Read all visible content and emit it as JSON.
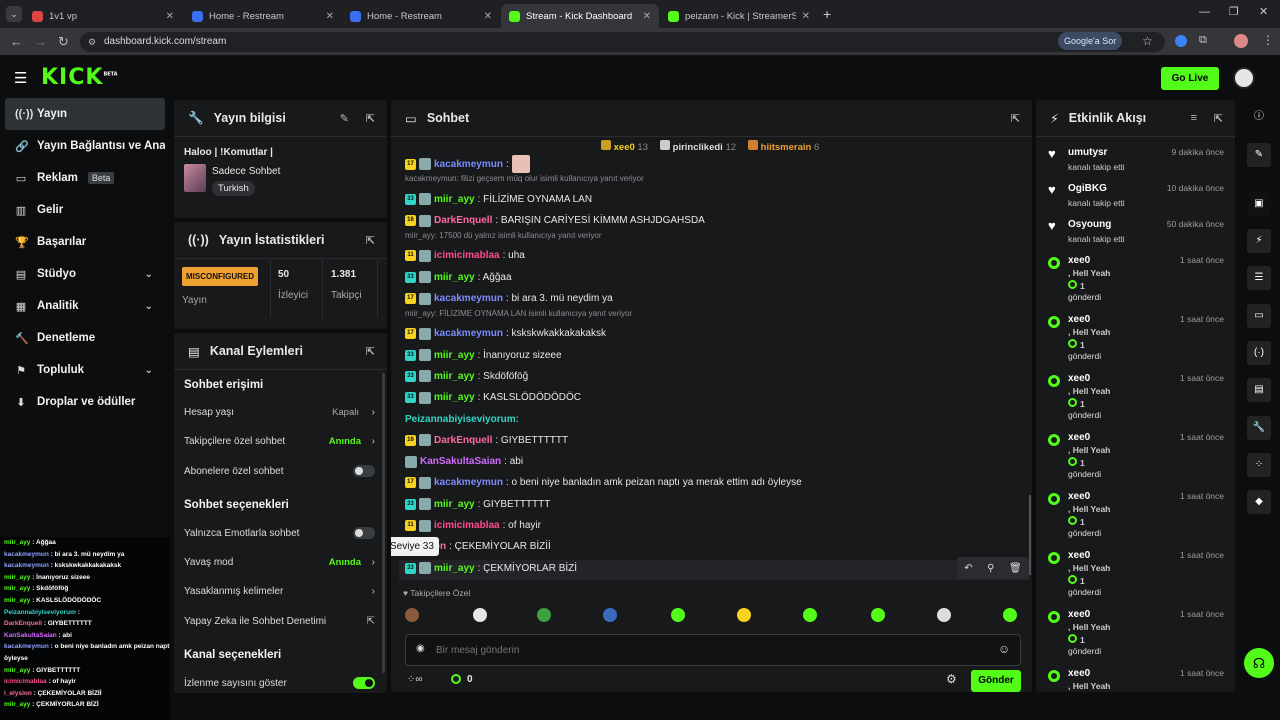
{
  "browser": {
    "tabs": [
      {
        "title": "1v1 vp",
        "color": "#d44"
      },
      {
        "title": "Home - Restream",
        "color": "#3b6df0"
      },
      {
        "title": "Home - Restream",
        "color": "#3b6df0"
      },
      {
        "title": "Stream - Kick Dashboard",
        "color": "#53fc18"
      },
      {
        "title": "peizann - Kick | StreamerStats",
        "color": "#53fc18"
      }
    ],
    "url": "dashboard.kick.com/stream",
    "google_btn": "Google'a Sor"
  },
  "header": {
    "logo": "KICK",
    "logo_sup": "BETA",
    "go_live": "Go Live"
  },
  "sidebar": {
    "items": [
      {
        "label": "Yayın",
        "icon": "broadcast-icon"
      },
      {
        "label": "Yayın Bağlantısı ve Anahtarı",
        "icon": "link-icon"
      },
      {
        "label": "Reklam",
        "icon": "ad-icon",
        "badge": "Beta"
      },
      {
        "label": "Gelir",
        "icon": "revenue-icon"
      },
      {
        "label": "Başarılar",
        "icon": "trophy-icon"
      },
      {
        "label": "Stüdyo",
        "icon": "studio-icon"
      },
      {
        "label": "Analitik",
        "icon": "analytics-icon"
      },
      {
        "label": "Denetleme",
        "icon": "moderation-icon"
      },
      {
        "label": "Topluluk",
        "icon": "community-icon"
      },
      {
        "label": "Droplar ve ödüller",
        "icon": "drops-icon"
      }
    ]
  },
  "stream_info": {
    "title": "Yayın bilgisi",
    "stream_title": "Haloo | !Komutlar |",
    "category": "Sadece Sohbet",
    "tag": "Turkish"
  },
  "stats": {
    "title": "Yayın İstatistikleri",
    "status": "MISCONFIGURED",
    "status_label": "Yayın",
    "viewers": "50",
    "viewers_label": "İzleyici",
    "followers": "1.381",
    "followers_label": "Takipçi"
  },
  "actions": {
    "title": "Kanal Eylemleri",
    "sec1": "Sohbet erişimi",
    "rows1": [
      {
        "label": "Hesap yaşı",
        "value": "Kapalı",
        "kind": "gray"
      },
      {
        "label": "Takipçilere özel sohbet",
        "value": "Anında",
        "kind": "green"
      },
      {
        "label": "Abonelere özel sohbet",
        "kind": "toggle"
      }
    ],
    "sec2": "Sohbet seçenekleri",
    "rows2": [
      {
        "label": "Yalnızca Emotlarla sohbet",
        "kind": "toggle"
      },
      {
        "label": "Yavaş mod",
        "value": "Anında",
        "kind": "green"
      },
      {
        "label": "Yasaklanmış kelimeler",
        "kind": "chev"
      },
      {
        "label": "Yapay Zeka ile Sohbet Denetimi",
        "kind": "ext"
      }
    ],
    "sec3": "Kanal seçenekleri",
    "row3": "İzlenme sayısını göster"
  },
  "chat": {
    "title": "Sohbet",
    "top": [
      {
        "name": "xee0",
        "count": "13",
        "color": "#f7d21f"
      },
      {
        "name": "pirinclikedi",
        "count": "12",
        "color": "#ddd"
      },
      {
        "name": "hiitsmerain",
        "count": "6",
        "color": "#f0a030"
      }
    ],
    "messages": [
      {
        "lv": "17",
        "lc": "y",
        "user": "kacakmeymun",
        "uc": "#7b8cff",
        "text": ": "
      },
      {
        "reply": "kacakmeymun: filizi geçsem müq olur isimli kullanıcıya yanıt veriyor"
      },
      {
        "lv": "33",
        "lc": "c",
        "user": "miir_ayy",
        "uc": "#53fc18",
        "text": ": FİLİZİME OYNAMA LAN"
      },
      {
        "lv": "16",
        "lc": "y",
        "user": "DarkEnquell",
        "uc": "#ff6aa0",
        "text": ": BARIŞIN CARİYESİ KİMMM ASHJDGAHSDA"
      },
      {
        "reply": "miir_ayy: 17500 dü yalnız isimli kullanıcıya yanıt veriyor"
      },
      {
        "lv": "11",
        "lc": "y",
        "user": "icimicimablaa",
        "uc": "#ff4d8d",
        "text": ": uha"
      },
      {
        "lv": "33",
        "lc": "c",
        "user": "miir_ayy",
        "uc": "#53fc18",
        "text": ": Ağğaa"
      },
      {
        "lv": "17",
        "lc": "y",
        "user": "kacakmeymun",
        "uc": "#7b8cff",
        "text": ": bi ara 3. mü neydim ya"
      },
      {
        "reply": "miir_ayy: FİLİZİME OYNAMA LAN isimli kullanıcıya yanıt veriyor"
      },
      {
        "lv": "17",
        "lc": "y",
        "user": "kacakmeymun",
        "uc": "#7b8cff",
        "text": ": kskskwkakkakakaksk"
      },
      {
        "lv": "33",
        "lc": "c",
        "user": "miir_ayy",
        "uc": "#53fc18",
        "text": ": İnanıyoruz sizeee"
      },
      {
        "lv": "33",
        "lc": "c",
        "user": "miir_ayy",
        "uc": "#53fc18",
        "text": ": Skdöföföğ"
      },
      {
        "lv": "33",
        "lc": "c",
        "user": "miir_ayy",
        "uc": "#53fc18",
        "text": ": KASLSLÖDÖDÖDÖC"
      },
      {
        "plain": "Peizannabiyiseviyorum:",
        "uc": "#2fd6c6"
      },
      {
        "lv": "16",
        "lc": "y",
        "user": "DarkEnquell",
        "uc": "#ff6aa0",
        "text": ": GIYBETTTTTT"
      },
      {
        "lv": "",
        "lc": "n",
        "user": "KanSakultaSaian",
        "uc": "#d26bff",
        "text": ": abi"
      },
      {
        "lv": "17",
        "lc": "y",
        "user": "kacakmeymun",
        "uc": "#7b8cff",
        "text": ": o beni niye banladın amk peizan naptı ya merak ettim adı öyleyse"
      },
      {
        "lv": "33",
        "lc": "c",
        "user": "miir_ayy",
        "uc": "#53fc18",
        "text": ": GIYBETTTTTT"
      },
      {
        "lv": "11",
        "lc": "y",
        "user": "icimicimablaa",
        "uc": "#ff4d8d",
        "text": ": of hayir"
      },
      {
        "lv": "",
        "lc": "n",
        "user": "ysion",
        "uc": "#ff6aa0",
        "text": ": ÇEKEMİYOLAR BİZİİ"
      },
      {
        "lv": "33",
        "lc": "c",
        "user": "miir_ayy",
        "uc": "#53fc18",
        "text": ": ÇEKMİYORLAR BİZİ"
      }
    ],
    "tooltip": "Seviye 33",
    "followers_only": "Takipçilere Özel",
    "placeholder": "Bir mesaj gönderin",
    "points": "0",
    "send": "Gönder"
  },
  "events": {
    "title": "Etkinlik Akışı",
    "items": [
      {
        "name": "umutysr",
        "sub": "kanalı takip etti",
        "time": "9 dakika önce",
        "kind": "follow"
      },
      {
        "name": "OgiBKG",
        "sub": "kanalı takip etti",
        "time": "10 dakika önce",
        "kind": "follow"
      },
      {
        "name": "Osyoung",
        "sub": "kanalı takip etti",
        "time": "50 dakika önce",
        "kind": "follow"
      },
      {
        "name": "xee0",
        "sub": ", Hell Yeah",
        "gift": "1",
        "gift_label": "gönderdi",
        "time": "1 saat önce",
        "kind": "gift"
      },
      {
        "name": "xee0",
        "sub": ", Hell Yeah",
        "gift": "1",
        "gift_label": "gönderdi",
        "time": "1 saat önce",
        "kind": "gift"
      },
      {
        "name": "xee0",
        "sub": ", Hell Yeah",
        "gift": "1",
        "gift_label": "gönderdi",
        "time": "1 saat önce",
        "kind": "gift"
      },
      {
        "name": "xee0",
        "sub": ", Hell Yeah",
        "gift": "1",
        "gift_label": "gönderdi",
        "time": "1 saat önce",
        "kind": "gift"
      },
      {
        "name": "xee0",
        "sub": ", Hell Yeah",
        "gift": "1",
        "gift_label": "gönderdi",
        "time": "1 saat önce",
        "kind": "gift"
      },
      {
        "name": "xee0",
        "sub": ", Hell Yeah",
        "gift": "1",
        "gift_label": "gönderdi",
        "time": "1 saat önce",
        "kind": "gift"
      },
      {
        "name": "xee0",
        "sub": ", Hell Yeah",
        "gift": "1",
        "gift_label": "gönderdi",
        "time": "1 saat önce",
        "kind": "gift"
      },
      {
        "name": "xee0",
        "sub": ", Hell Yeah",
        "gift": "",
        "gift_label": "",
        "time": "1 saat önce",
        "kind": "gift"
      }
    ]
  },
  "overlay_chat": [
    {
      "u": "miir_ayy",
      "c": "#53fc18",
      "t": " : Ağğaa"
    },
    {
      "u": "kacakmeymun",
      "c": "#8fa0ff",
      "t": " : bi ara 3. mü neydim ya"
    },
    {
      "u": "kacakmeymun",
      "c": "#8fa0ff",
      "t": " : kskskwkakkakakaksk"
    },
    {
      "u": "miir_ayy",
      "c": "#53fc18",
      "t": " : İnanıyoruz sizeee"
    },
    {
      "u": "miir_ayy",
      "c": "#53fc18",
      "t": " : Skdöföföğ"
    },
    {
      "u": "miir_ayy",
      "c": "#53fc18",
      "t": " : KASLSLÖDÖDÖDÖC"
    },
    {
      "u": "Peizannabiyiseviyorum",
      "c": "#2fd6c6",
      "t": " :"
    },
    {
      "u": "DarkEnquell",
      "c": "#ff6aa0",
      "t": " : GIYBETTTTTT"
    },
    {
      "u": "KanSakultaSaian",
      "c": "#d26bff",
      "t": " : abi"
    },
    {
      "u": "kacakmeymun",
      "c": "#8fa0ff",
      "t": " : o beni niye banladın amk peizan naptı ya merak ettim adı"
    },
    {
      "u": "öyleyse",
      "c": "#ffffff",
      "t": ""
    },
    {
      "u": "miir_ayy",
      "c": "#53fc18",
      "t": " : GIYBETTTTTT"
    },
    {
      "u": "icimicimablaa",
      "c": "#ff4d8d",
      "t": " : of hayir"
    },
    {
      "u": "l_elysion",
      "c": "#ff6aa0",
      "t": " : ÇEKEMİYOLAR BİZİİ"
    },
    {
      "u": "miir_ayy",
      "c": "#53fc18",
      "t": " : ÇEKMİYORLAR BİZİ"
    }
  ]
}
